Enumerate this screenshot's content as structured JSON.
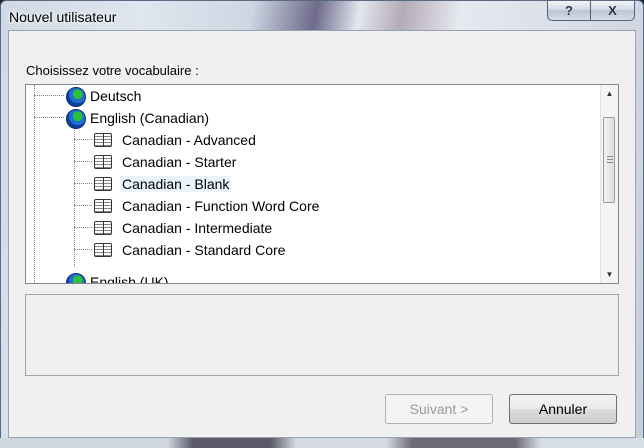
{
  "window": {
    "title": "Nouvel utilisateur",
    "help_glyph": "?",
    "close_glyph": "X"
  },
  "prompt": "Choisissez votre vocabulaire :",
  "tree": {
    "items": [
      {
        "label": "Deutsch",
        "type": "language",
        "icon": "globe-icon"
      },
      {
        "label": "English (Canadian)",
        "type": "language",
        "icon": "globe-icon"
      },
      {
        "label": "Canadian - Advanced",
        "type": "vocabulary",
        "icon": "book-icon"
      },
      {
        "label": "Canadian - Starter",
        "type": "vocabulary",
        "icon": "book-icon"
      },
      {
        "label": "Canadian - Blank",
        "type": "vocabulary",
        "icon": "book-icon",
        "selected": true
      },
      {
        "label": "Canadian - Function Word Core",
        "type": "vocabulary",
        "icon": "book-icon"
      },
      {
        "label": "Canadian - Intermediate",
        "type": "vocabulary",
        "icon": "book-icon"
      },
      {
        "label": "Canadian - Standard Core",
        "type": "vocabulary",
        "icon": "book-icon"
      },
      {
        "label": "English (UK)",
        "type": "language",
        "icon": "globe-icon",
        "partially_visible": true
      }
    ]
  },
  "buttons": {
    "next": "Suivant >",
    "cancel": "Annuler"
  },
  "colors": {
    "selection_bg": "#eaf2fb",
    "disabled_text": "#9a9a9a"
  }
}
